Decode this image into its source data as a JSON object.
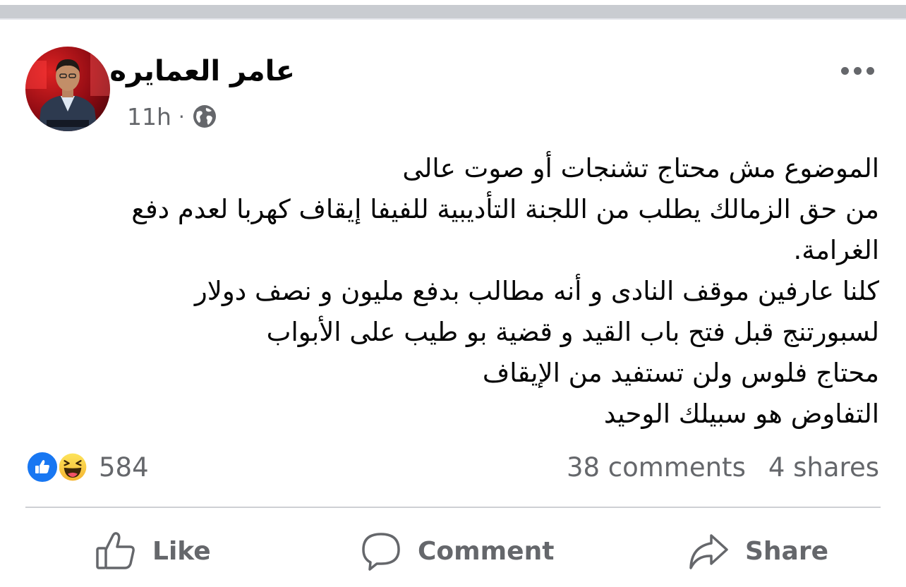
{
  "post": {
    "author": "عامر العمايره",
    "time": "11h",
    "separator": "·",
    "privacy_icon": "globe-icon",
    "menu_icon": "more-options-icon",
    "body_lines": [
      "الموضوع مش محتاج تشنجات أو صوت عالى",
      "من حق الزمالك يطلب من اللجنة التأديبية للفيفا إيقاف كهربا لعدم دفع",
      "الغرامة.",
      "كلنا عارفين موقف النادى و أنه مطالب بدفع مليون و نصف دولار",
      "لسبورتنج قبل فتح باب القيد و قضية بو طيب على الأبواب",
      "محتاج فلوس ولن تستفيد من الإيقاف",
      "التفاوض هو سبيلك الوحيد"
    ]
  },
  "reactions": {
    "icons": [
      "like-reaction-icon",
      "haha-reaction-icon"
    ],
    "count": "584"
  },
  "engagement": {
    "comments": "38 comments",
    "shares": "4 shares"
  },
  "actions": {
    "like_label": "Like",
    "comment_label": "Comment",
    "share_label": "Share"
  },
  "colors": {
    "secondary_text": "#65676b",
    "like_blue": "#1877f2",
    "divider": "#ced0d4"
  }
}
